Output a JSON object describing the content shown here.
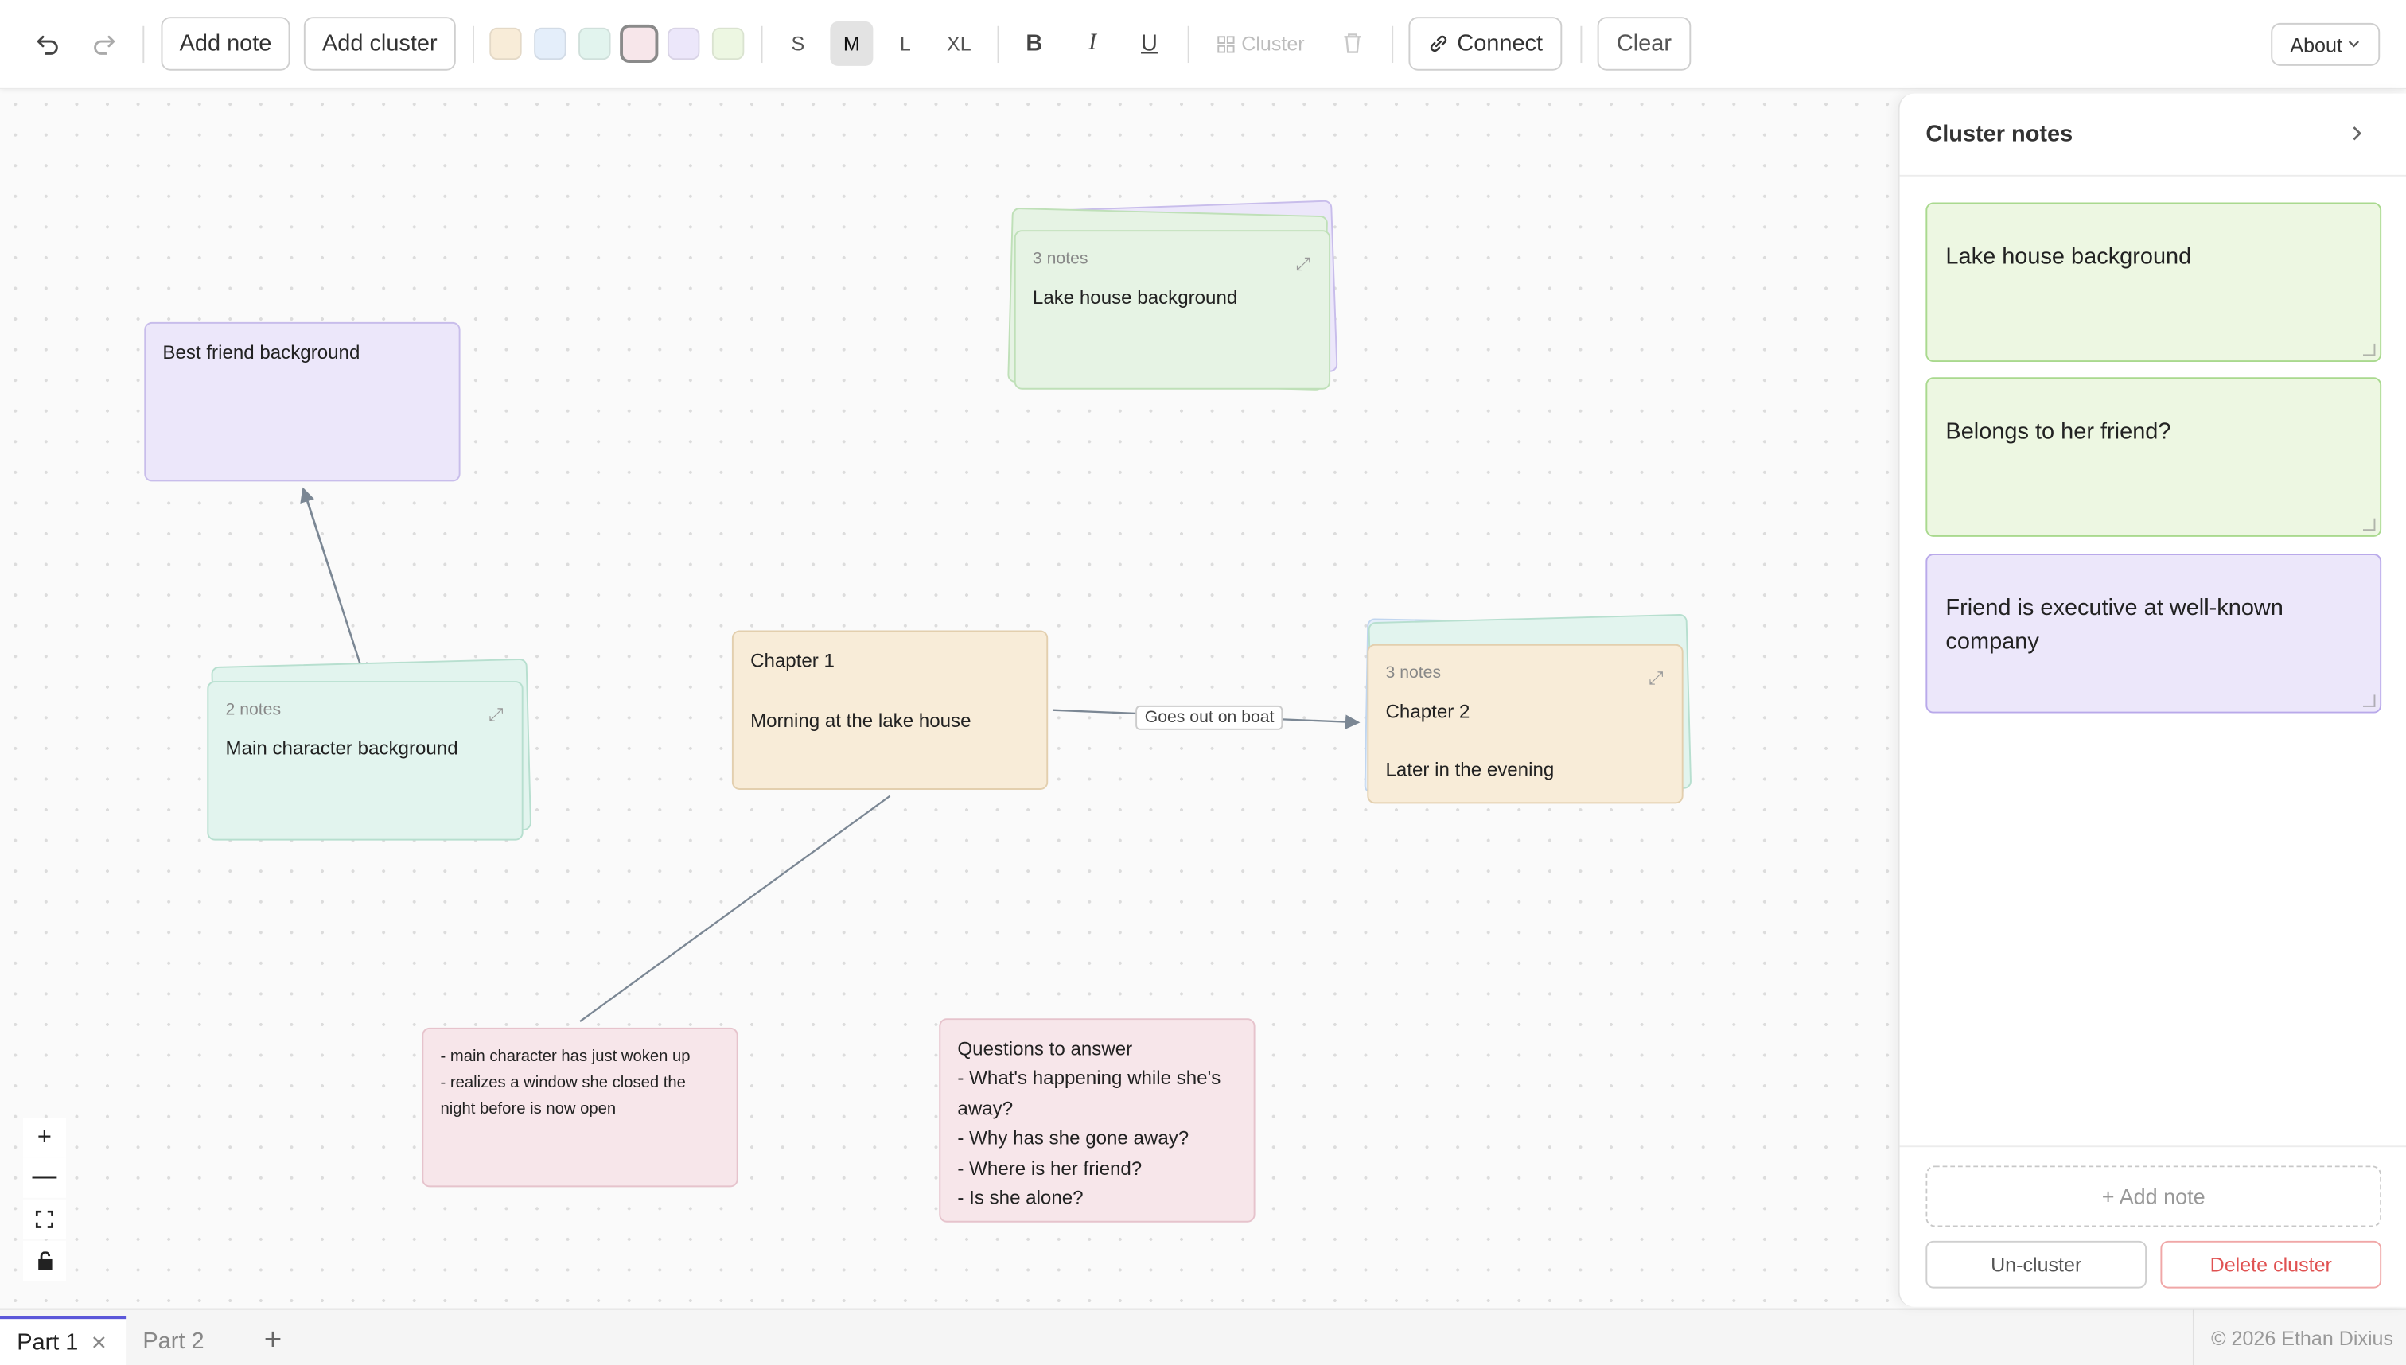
{
  "toolbar": {
    "undo_icon": "undo-icon",
    "redo_icon": "redo-icon",
    "add_note_label": "Add note",
    "add_cluster_label": "Add cluster",
    "colors": [
      "#f8ecd8",
      "#e4eefa",
      "#e2f4ee",
      "#f7e6ea",
      "#ece7fa",
      "#edf7e2"
    ],
    "selected_color": "#f7e6ea",
    "sizes": [
      "S",
      "M",
      "L",
      "XL"
    ],
    "selected_size": "M",
    "bold_label": "B",
    "italic_label": "I",
    "underline_label": "U",
    "cluster_label": "Cluster",
    "connect_label": "Connect",
    "clear_label": "Clear",
    "about_label": "About"
  },
  "canvas": {
    "notes": {
      "best_friend": "Best friend background",
      "chapter1_title": "Chapter 1",
      "chapter1_body": "Morning at the lake house",
      "checklist_line1": "- main character has just woken up",
      "checklist_line2": "- realizes a window she closed the night before is now open",
      "questions_title": "Questions to answer",
      "questions": [
        "- What's happening while she's away?",
        "- Why has she gone away?",
        "- Where is her friend?",
        "- Is she alone?"
      ]
    },
    "clusters": {
      "lake_house": {
        "count": "3 notes",
        "title": "Lake house background"
      },
      "main_character": {
        "count": "2 notes",
        "title": "Main character background"
      },
      "chapter2": {
        "count": "3 notes",
        "title": "Chapter 2",
        "body": "Later in the evening"
      }
    },
    "edge_label": "Goes out on boat",
    "zoom_in": "+",
    "zoom_out": "—"
  },
  "panel": {
    "title": "Cluster notes",
    "notes": [
      {
        "text": "Lake house background",
        "color": "#edf7e2"
      },
      {
        "text": "Belongs to her friend?",
        "color": "#edf7e2"
      },
      {
        "text": "Friend is executive at well-known company",
        "color": "#ece7fa"
      }
    ],
    "add_note_label": "+ Add note",
    "uncluster_label": "Un-cluster",
    "delete_cluster_label": "Delete cluster"
  },
  "tabs": {
    "items": [
      "Part 1",
      "Part 2"
    ],
    "active": "Part 1",
    "add": "+",
    "copyright": "© 2026 Ethan Dixius"
  }
}
